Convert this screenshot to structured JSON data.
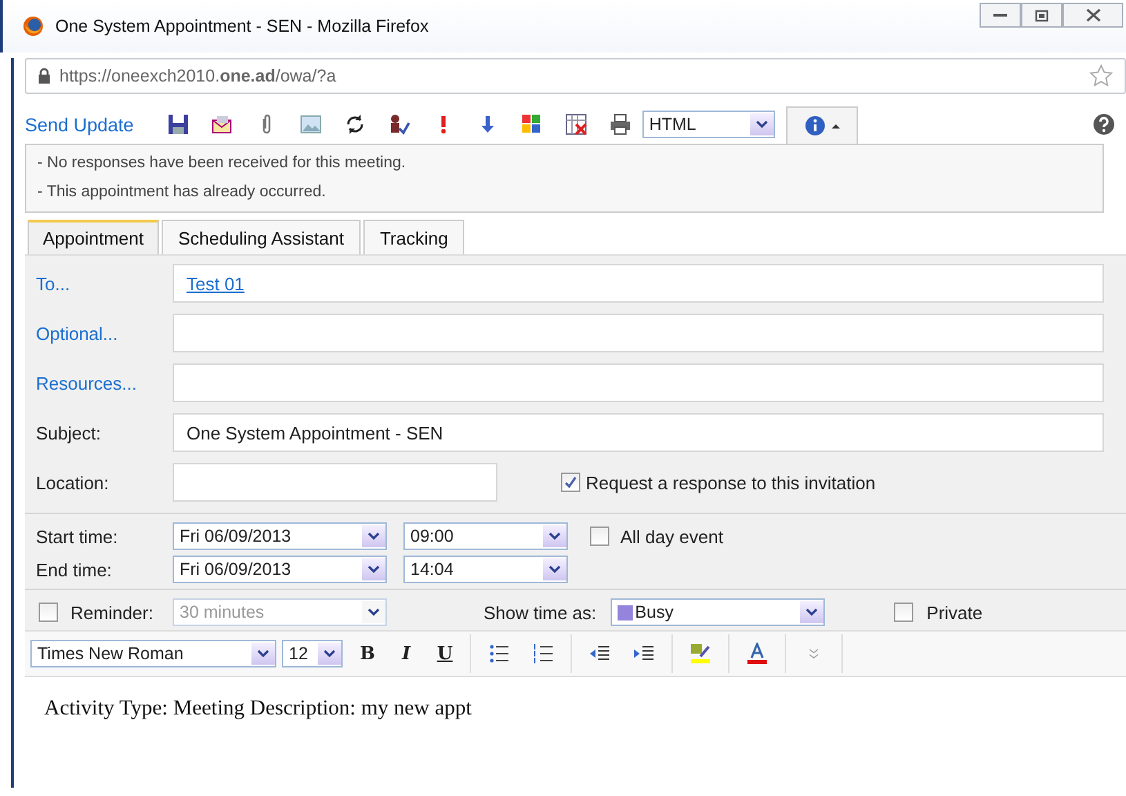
{
  "window": {
    "title": "One System Appointment - SEN - Mozilla Firefox"
  },
  "address_bar": {
    "url": "https://oneexch2010.**one.ad**/owa/?a"
  },
  "toolbar": {
    "send_label": "Send Update",
    "format": "HTML",
    "info_expanded": true
  },
  "info_messages": [
    "- No responses have been received for this meeting.",
    "- This appointment has already occurred."
  ],
  "tabs": [
    {
      "label": "Appointment",
      "selected": true
    },
    {
      "label": "Scheduling Assistant",
      "selected": false
    },
    {
      "label": "Tracking",
      "selected": false
    }
  ],
  "recipients": [
    {
      "label": "To...",
      "value": "Test 01"
    },
    {
      "label": "Optional..."
    },
    {
      "label": "Resources..."
    }
  ],
  "subject": {
    "label": "Subject:",
    "value": "One System Appointment - SEN"
  },
  "location": {
    "label": "Location:"
  },
  "request_response": {
    "label": "Request a response to this invitation",
    "checked": true
  },
  "times": [
    {
      "label": "Start time:",
      "date": "Fri 06/09/2013",
      "time": "09:00"
    },
    {
      "label": "End time:",
      "date": "Fri 06/09/2013",
      "time": "14:04"
    }
  ],
  "all_day": {
    "label": "All day event",
    "checked": false
  },
  "reminder": {
    "label": "Reminder:",
    "checked": false,
    "value": "30 minutes",
    "disabled": true
  },
  "show_time_as": {
    "label": "Show time as:",
    "value": "Busy",
    "color": "#9484dc"
  },
  "private": {
    "label": "Private",
    "checked": false
  },
  "editor_toolbar": {
    "font": "Times New Roman",
    "size": "12",
    "bold": "B",
    "italic": "I",
    "underline": "U"
  },
  "body": "Activity Type: Meeting Description: my new appt"
}
